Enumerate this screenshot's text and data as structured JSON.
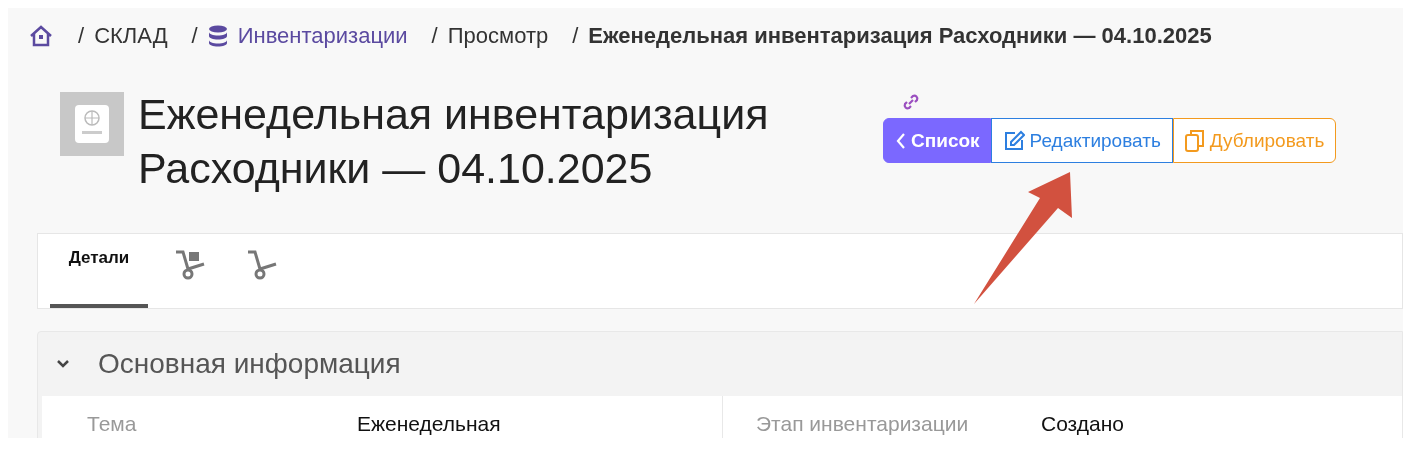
{
  "breadcrumb": [
    {
      "kind": "home"
    },
    {
      "kind": "text",
      "separator": "/",
      "label": "СКЛАД"
    },
    {
      "kind": "link",
      "separator": "/",
      "label": "Инвентаризации"
    },
    {
      "kind": "text",
      "separator": "/",
      "label": "Просмотр"
    },
    {
      "kind": "current",
      "separator": "/",
      "label": "Еженедельная инвентаризация Расходники — 04.10.2025"
    }
  ],
  "title": "Еженедельная инвентаризация Расходники — 04.10.2025",
  "buttons": [
    {
      "kind": "list",
      "label": "Список"
    },
    {
      "kind": "edit",
      "label": "Редактировать"
    },
    {
      "kind": "duplicate",
      "label": "Дублировать"
    }
  ],
  "tabs": [
    {
      "kind": "text",
      "label": "Детали",
      "selected": true
    },
    {
      "kind": "cart",
      "selected": false
    },
    {
      "kind": "dolly",
      "selected": false
    }
  ],
  "section": {
    "title": "Основная информация",
    "expanded": true,
    "fields": [
      {
        "label": "Тема",
        "value": "Еженедельная"
      },
      {
        "label": "Этап инвентаризации",
        "value": "Создано"
      }
    ]
  }
}
